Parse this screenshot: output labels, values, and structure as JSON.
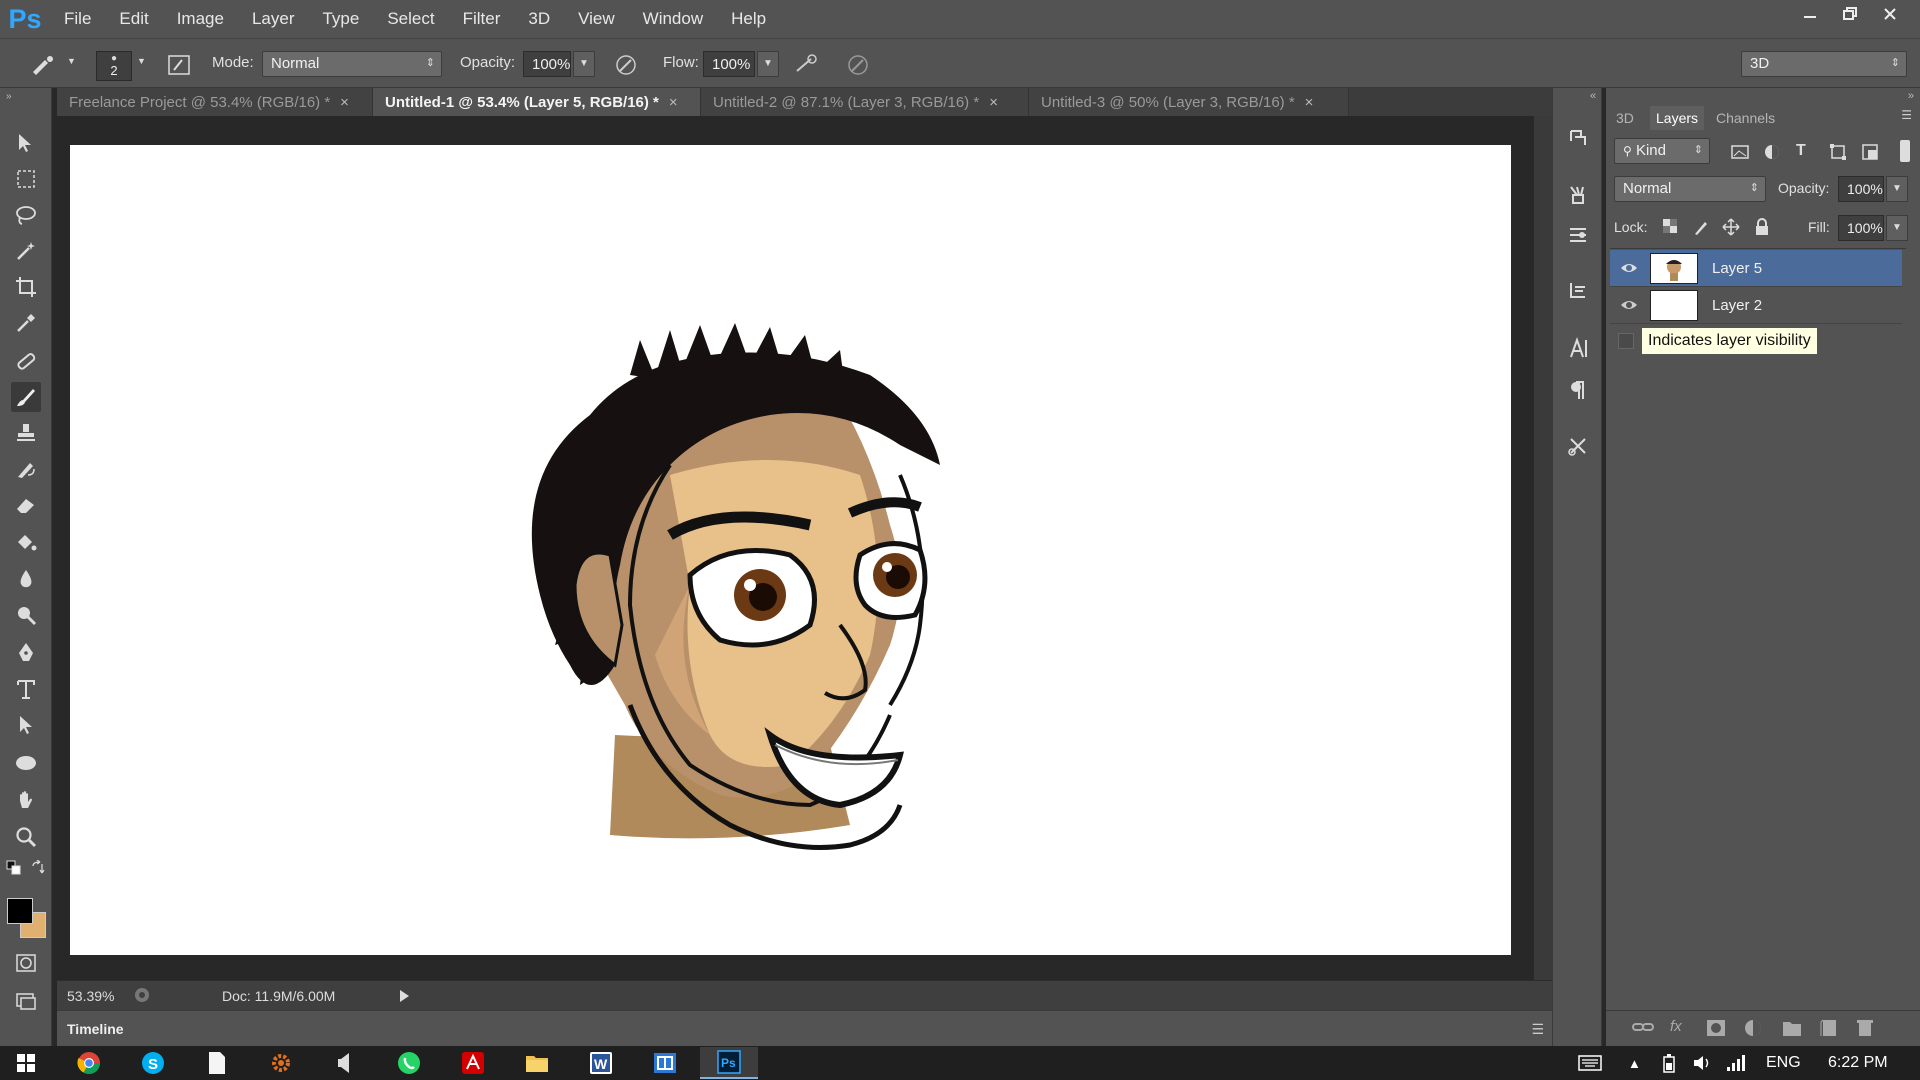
{
  "app": {
    "logo": "Ps"
  },
  "menu": [
    "File",
    "Edit",
    "Image",
    "Layer",
    "Type",
    "Select",
    "Filter",
    "3D",
    "View",
    "Window",
    "Help"
  ],
  "options": {
    "brush_size": "2",
    "mode_label": "Mode:",
    "mode_value": "Normal",
    "opacity_label": "Opacity:",
    "opacity_value": "100%",
    "flow_label": "Flow:",
    "flow_value": "100%",
    "workspace": "3D"
  },
  "tabs": [
    {
      "label": "Freelance Project @ 53.4% (RGB/16) *",
      "close": "×"
    },
    {
      "label": "Untitled-1 @ 53.4% (Layer 5, RGB/16) *",
      "close": "×"
    },
    {
      "label": "Untitled-2 @ 87.1% (Layer 3, RGB/16) *",
      "close": "×"
    },
    {
      "label": "Untitled-3 @ 50% (Layer 3, RGB/16) *",
      "close": "×"
    }
  ],
  "status": {
    "zoom": "53.39%",
    "doc": "Doc: 11.9M/6.00M"
  },
  "timeline": {
    "label": "Timeline"
  },
  "layers_panel": {
    "tabs": [
      "3D",
      "Layers",
      "Channels"
    ],
    "kind_label": "Kind",
    "blend_mode": "Normal",
    "opacity_label": "Opacity:",
    "opacity_value": "100%",
    "lock_label": "Lock:",
    "fill_label": "Fill:",
    "fill_value": "100%",
    "layers": [
      {
        "name": "Layer 5",
        "visible": true,
        "selected": true
      },
      {
        "name": "Layer 2",
        "visible": true,
        "selected": false
      }
    ],
    "tooltip": "Indicates layer visibility"
  },
  "taskbar": {
    "language": "ENG",
    "time": "6:22 PM"
  },
  "colors": {
    "foreground": "#000000",
    "background": "#e0b070",
    "skin": "#d0a67a",
    "selected_layer": "#4b6c9b"
  }
}
